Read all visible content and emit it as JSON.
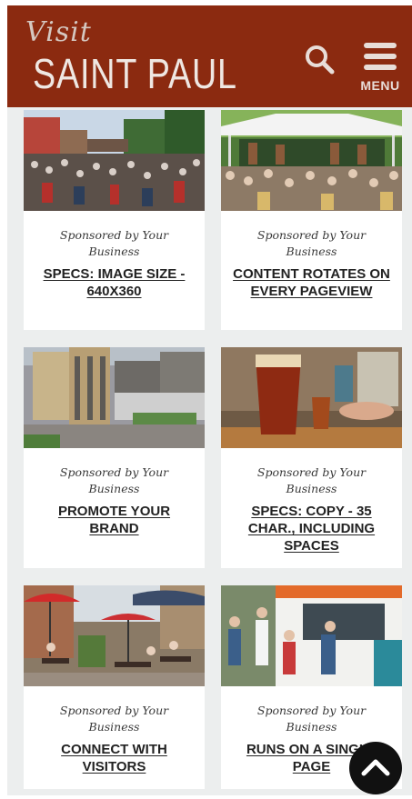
{
  "header": {
    "logo_visit": "Visit",
    "logo_main": "SAINT PAUL",
    "menu_label": "MENU",
    "bg_color": "#8b2a10"
  },
  "cards": [
    {
      "sponsor": "Sponsored by Your Business",
      "title": "SPECS: IMAGE SIZE - 640X360",
      "image": "street-festival-crowd"
    },
    {
      "sponsor": "Sponsored by Your Business",
      "title": "CONTENT ROTATES ON EVERY PAGEVIEW",
      "image": "outdoor-concert-tent"
    },
    {
      "sponsor": "Sponsored by Your Business",
      "title": "PROMOTE YOUR BRAND",
      "image": "downtown-aerial"
    },
    {
      "sponsor": "Sponsored by Your Business",
      "title": "SPECS: COPY - 35 CHAR., INCLUDING SPACES",
      "image": "beer-glass"
    },
    {
      "sponsor": "Sponsored by Your Business",
      "title": "CONNECT WITH VISITORS",
      "image": "patio-dining"
    },
    {
      "sponsor": "Sponsored by Your Business",
      "title": "RUNS ON A SINGLE PAGE",
      "image": "food-truck"
    }
  ],
  "icons": {
    "search": "search-icon",
    "menu": "hamburger-menu-icon",
    "scroll_top": "chevron-up-icon"
  }
}
